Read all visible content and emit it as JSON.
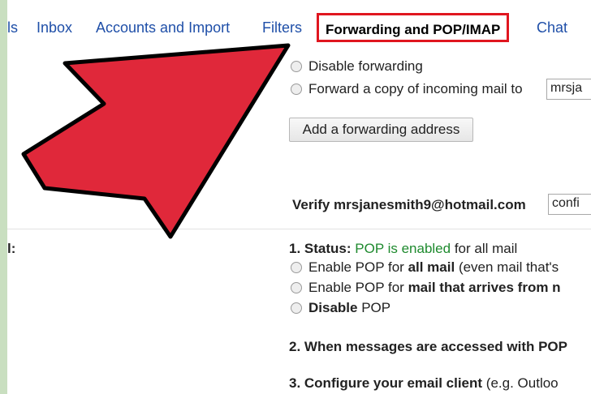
{
  "tabs": [
    {
      "label": "ls"
    },
    {
      "label": "Inbox"
    },
    {
      "label": "Accounts and Import"
    },
    {
      "label": "Filters"
    },
    {
      "label": "Forwarding and POP/IMAP"
    },
    {
      "label": "Chat"
    }
  ],
  "forwarding": {
    "disable_label": "Disable forwarding",
    "forward_label": "Forward a copy of incoming mail to",
    "forward_value": "mrsja",
    "add_button": "Add a forwarding address",
    "verify_label": "Verify mrsjanesmith9@hotmail.com",
    "verify_value": "confi"
  },
  "pop": {
    "section_label": "l:",
    "status_prefix": "1. Status:",
    "status_value": "POP is enabled",
    "status_suffix": "for all mail",
    "option1_prefix": "Enable POP for",
    "option1_bold": "all mail",
    "option1_suffix": "(even mail that's",
    "option2_prefix": "Enable POP for",
    "option2_bold": "mail that arrives from n",
    "option3_bold": "Disable",
    "option3_suffix": "POP",
    "step2": "2. When messages are accessed with POP",
    "step3_bold": "3. Configure your email client",
    "step3_suffix": "(e.g. Outloo"
  },
  "colors": {
    "highlight_border": "#e0161f",
    "arrow_fill": "#e0283a",
    "link_blue": "#1f4fa8",
    "status_green": "#1e8a2e",
    "frame_green": "#c9dfc0"
  }
}
